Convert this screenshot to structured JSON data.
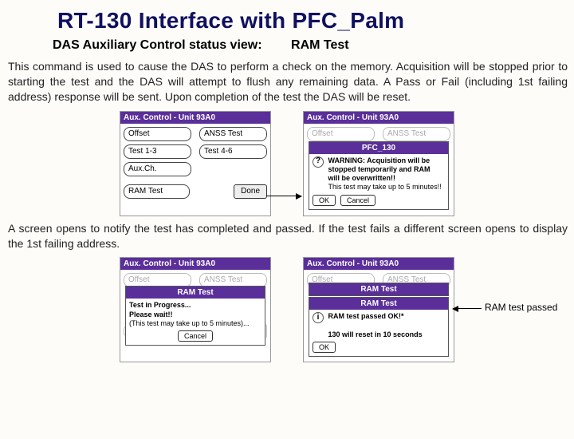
{
  "title": "RT-130 Interface with PFC_Palm",
  "subtitle_left": "DAS Auxiliary Control status view:",
  "subtitle_right": "RAM Test",
  "para1": "This command is used to cause the DAS to perform a check on the memory. Acquisition will be stopped prior to starting the test and the DAS will attempt to flush any remaining data. A Pass or Fail (including 1st failing address) response will be sent.   Upon completion of the test the DAS will be reset.",
  "para2": "A screen opens to notify the test has completed and passed. If the test fails a different screen opens to display the 1st failing address.",
  "buttons": {
    "offset": "Offset",
    "anss": "ANSS Test",
    "test13": "Test 1-3",
    "test46": "Test 4-6",
    "auxch": "Aux.Ch.",
    "ram": "RAM Test",
    "done": "Done"
  },
  "panel_header": "Aux. Control - Unit 93A0",
  "warn_dialog": {
    "title": "PFC_130",
    "icon_char": "?",
    "bold1": "WARNING: Acquisition will be stopped temporarily and RAM will be overwritten!!",
    "plain1": "This test may take up to 5 minutes!!",
    "ok": "OK",
    "cancel": "Cancel"
  },
  "progress_dialog": {
    "title": "RAM Test",
    "line1": "Test in Progress...",
    "line2": "Please wait!!",
    "line3": "(This test may take up to 5 minutes)...",
    "cancel": "Cancel"
  },
  "pass_dialog": {
    "title_top": "RAM Test",
    "title": "RAM Test",
    "icon_char": "i",
    "line1": "RAM test passed OK!*",
    "line2": "130 will reset in 10 seconds",
    "ok": "OK"
  },
  "callout_text": "RAM test passed"
}
